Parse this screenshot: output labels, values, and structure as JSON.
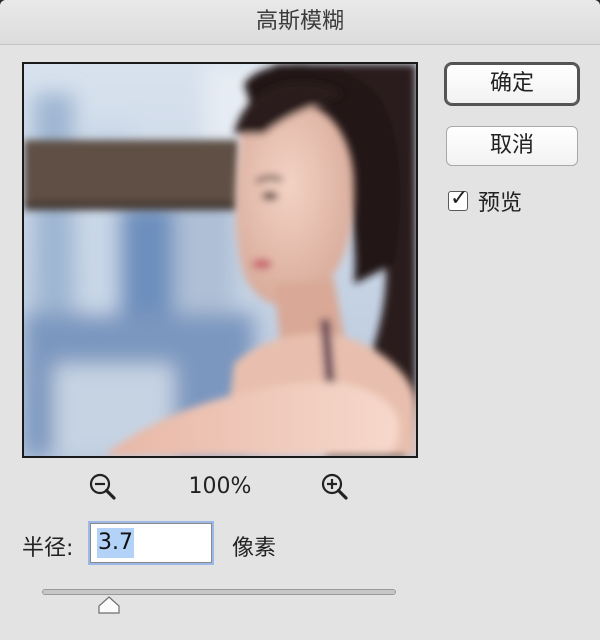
{
  "dialog": {
    "title": "高斯模糊"
  },
  "buttons": {
    "ok_label": "确定",
    "cancel_label": "取消"
  },
  "preview_option": {
    "label": "预览",
    "checked": true
  },
  "zoom": {
    "level": "100%",
    "zoom_out_icon": "zoom-out-icon",
    "zoom_in_icon": "zoom-in-icon"
  },
  "radius": {
    "label": "半径:",
    "value": "3.7",
    "unit": "像素",
    "slider_fraction": 0.19
  },
  "colors": {
    "dialog_bg": "#e3e3e3",
    "input_focus": "#9cb8e8",
    "selection": "#b2d2f7"
  }
}
